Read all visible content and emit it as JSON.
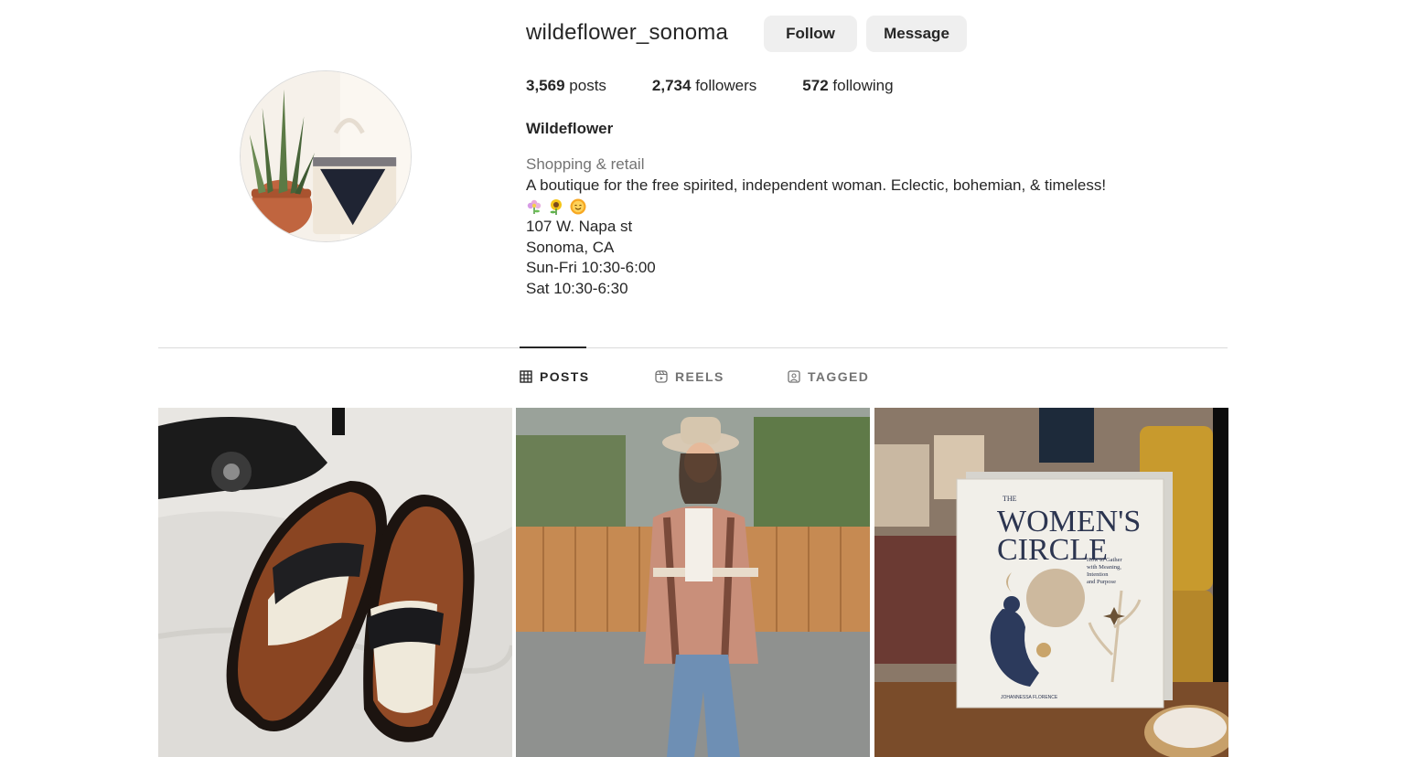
{
  "profile": {
    "username": "wildeflower_sonoma",
    "follow_label": "Follow",
    "message_label": "Message",
    "stats": {
      "posts_count": "3,569",
      "posts_label": "posts",
      "followers_count": "2,734",
      "followers_label": "followers",
      "following_count": "572",
      "following_label": "following"
    },
    "bio": {
      "name": "Wildeflower",
      "category": "Shopping & retail",
      "description": "A boutique for the free spirited, independent woman. Eclectic, bohemian, & timeless!",
      "emojis": [
        "flower-emoji",
        "sunflower-emoji",
        "sun-face-emoji"
      ],
      "address_line1": "107 W. Napa st",
      "address_line2": "Sonoma, CA",
      "hours_line1": "Sun-Fri 10:30-6:00",
      "hours_line2": "Sat 10:30-6:30"
    }
  },
  "tabs": [
    {
      "label": "POSTS",
      "icon": "grid-icon",
      "active": true
    },
    {
      "label": "REELS",
      "icon": "reels-icon",
      "active": false
    },
    {
      "label": "TAGGED",
      "icon": "tagged-icon",
      "active": false
    }
  ],
  "posts": [
    {
      "subject": "shoes-photo"
    },
    {
      "subject": "woman-poncho-photo"
    },
    {
      "subject": "book-photo"
    }
  ],
  "book_cover": {
    "title_the": "THE",
    "title_line1": "WOMEN'S",
    "title_line2": "CIRCLE",
    "subtitle_line1": "How to Gather",
    "subtitle_line2": "with Meaning,",
    "subtitle_line3": "Intention",
    "subtitle_line4": "and Purpose",
    "author": "JOHANNESSA FLORENCE"
  },
  "colors": {
    "text": "#262626",
    "secondary_text": "#737373",
    "button_bg": "#efefef",
    "divider": "#dbdbdb"
  }
}
